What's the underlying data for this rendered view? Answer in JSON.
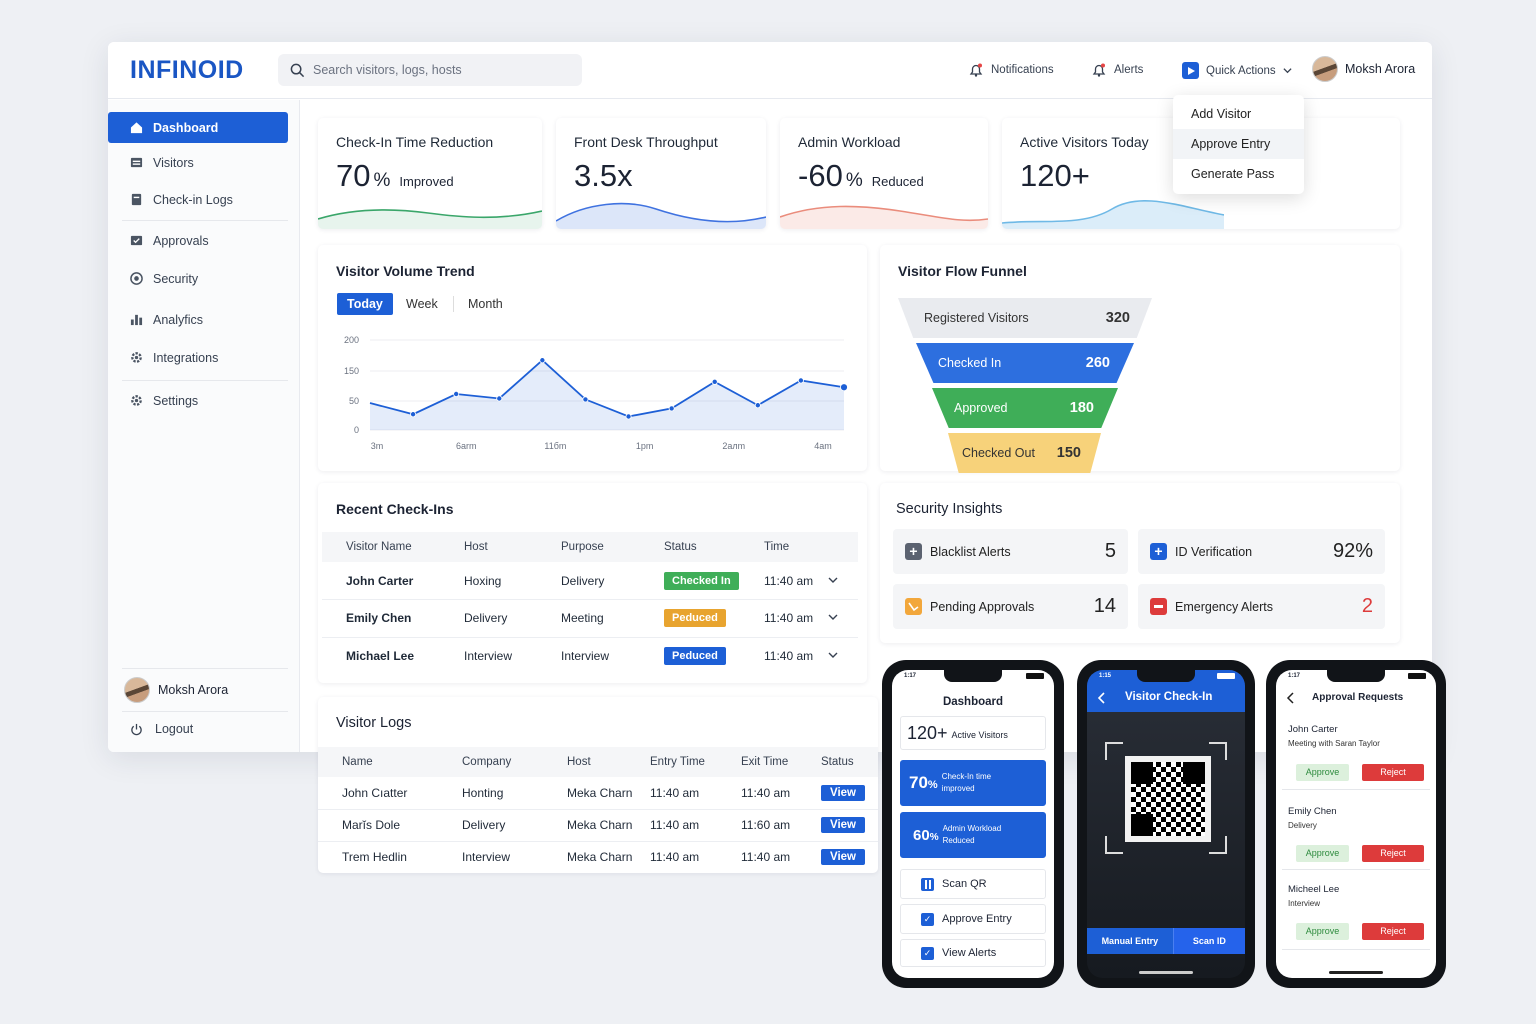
{
  "app": {
    "logo": "INFINOID"
  },
  "topbar": {
    "search_placeholder": "Search visitors, logs, hosts",
    "notifications": "Notifications",
    "alerts": "Alerts",
    "quick_actions": "Quick Actions",
    "user_name": "Moksh Arora"
  },
  "quick_actions_menu": [
    "Add Visitor",
    "Approve Entry",
    "Generate Pass"
  ],
  "sidebar": {
    "items": [
      {
        "label": "Dashboard",
        "icon": "home-icon"
      },
      {
        "label": "Visitors",
        "icon": "visitors-icon"
      },
      {
        "label": "Check-in Logs",
        "icon": "logs-icon"
      },
      {
        "label": "Approvals",
        "icon": "approvals-icon"
      },
      {
        "label": "Security",
        "icon": "security-icon"
      },
      {
        "label": "Analyfics",
        "icon": "analytics-icon"
      },
      {
        "label": "Integrations",
        "icon": "integrations-icon"
      },
      {
        "label": "Settings",
        "icon": "gear-icon"
      }
    ],
    "user_name": "Moksh Arora",
    "logout": "Logout"
  },
  "kpis": [
    {
      "title": "Check-In Time Reduction",
      "value": "70",
      "unit": "%",
      "sub": "Improved",
      "color": "#3aa66a"
    },
    {
      "title": "Front Desk Throughput",
      "value": "3.5x",
      "unit": "",
      "sub": "",
      "color": "#3f72e0"
    },
    {
      "title": "Admin Workload",
      "value": "-60",
      "unit": "%",
      "sub": "Reduced",
      "color": "#ea8c7c"
    },
    {
      "title": "Active Visitors Today",
      "value": "120+",
      "unit": "",
      "sub": "",
      "color": "#6fb9e6"
    }
  ],
  "trend": {
    "title": "Visitor Volume Trend",
    "tabs": [
      "Today",
      "Week",
      "Month"
    ]
  },
  "chart_data": {
    "type": "line",
    "title": "Visitor Volume Trend",
    "y_ticks": [
      "200",
      "150",
      "50",
      "0"
    ],
    "x_ticks": [
      "3m",
      "6arm",
      "11бm",
      "1pm",
      "2aлm",
      "4am"
    ],
    "values": [
      60,
      35,
      80,
      70,
      155,
      68,
      30,
      48,
      107,
      55,
      110,
      95
    ],
    "ylim": [
      0,
      200
    ],
    "color": "#1d5fd6"
  },
  "funnel": {
    "title": "Visitor Flow Funnel",
    "stages": [
      {
        "label": "Registered Visitors",
        "value": "320",
        "color": "#e9ebef"
      },
      {
        "label": "Checked In",
        "value": "260",
        "color": "#2d6fdf"
      },
      {
        "label": "Approved",
        "value": "180",
        "color": "#3fae58"
      },
      {
        "label": "Checked Out",
        "value": "150",
        "color": "#f7d27a"
      }
    ]
  },
  "recent": {
    "title": "Recent Check-Ins",
    "headers": [
      "Visitor Name",
      "Host",
      "Purpose",
      "Status",
      "Time"
    ],
    "rows": [
      {
        "name": "John Carter",
        "host": "Hoxing",
        "purpose": "Delivery",
        "status": "Checked In",
        "status_color": "#3fae58",
        "time": "11:40 am"
      },
      {
        "name": "Emily Chen",
        "host": "Delivery",
        "purpose": "Meeting",
        "status": "Peduced",
        "status_color": "#e8a42f",
        "time": "11:40 am"
      },
      {
        "name": "Michael Lee",
        "host": "Interview",
        "purpose": "Interview",
        "status": "Peduced",
        "status_color": "#1d5fd6",
        "time": "11:40 am"
      }
    ]
  },
  "logs": {
    "title": "Visitor Logs",
    "headers": [
      "Name",
      "Company",
      "Host",
      "Entry Time",
      "Exit Time",
      "Status"
    ],
    "rows": [
      {
        "name": "John Cıatter",
        "company": "Honting",
        "host": "Meka Charn",
        "entry": "11:40 am",
        "exit": "11:40 am",
        "action": "View"
      },
      {
        "name": "Marĭs Dole",
        "company": "Delivery",
        "host": "Meka Charn",
        "entry": "11:40 am",
        "exit": "11:60 am",
        "action": "View"
      },
      {
        "name": "Trem Hedlin",
        "company": "Interview",
        "host": "Meka Charn",
        "entry": "11:40 am",
        "exit": "11:40 am",
        "action": "View"
      }
    ]
  },
  "security": {
    "title": "Security Insights",
    "items": [
      {
        "label": "Blacklist Alerts",
        "value": "5",
        "icon_color": "#5b6270",
        "value_color": "#1c2333"
      },
      {
        "label": "ID Verification",
        "value": "92%",
        "icon_color": "#1d5fd6",
        "value_color": "#1c2333"
      },
      {
        "label": "Pending Approvals",
        "value": "14",
        "icon_color": "#f2a73b",
        "value_color": "#1c2333"
      },
      {
        "label": "Emergency Alerts",
        "value": "2",
        "icon_color": "#dd3b3b",
        "value_color": "#dd3b3b"
      }
    ]
  },
  "phone1": {
    "time": "1:17",
    "title": "Dashboard",
    "active_value": "120+",
    "active_label": "Active Visitors",
    "tile1_value": "70",
    "tile1_unit": "%",
    "tile1_label1": "Check-In time",
    "tile1_label2": "improved",
    "tile2_value": "60",
    "tile2_unit": "%",
    "tile2_label1": "Admin Workload",
    "tile2_label2": "Reduced",
    "actions": [
      "Scan QR",
      "Approve Entry",
      "View Alerts"
    ]
  },
  "phone2": {
    "time": "1:15",
    "title": "Visitor Check-In",
    "manual": "Manual Entry",
    "scan": "Scan ID"
  },
  "phone3": {
    "time": "1:17",
    "title": "Approval Requests",
    "requests": [
      {
        "name": "John Carter",
        "detail": "Meeting with Saran Taylor"
      },
      {
        "name": "Emily Chen",
        "detail": "Delivery"
      },
      {
        "name": "Micheel Lee",
        "detail": "Interview"
      }
    ],
    "approve": "Approve",
    "reject": "Reject"
  }
}
